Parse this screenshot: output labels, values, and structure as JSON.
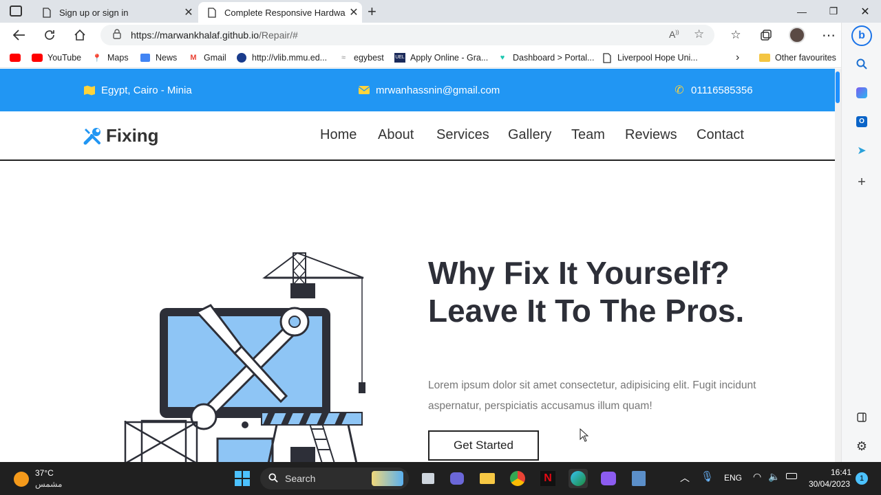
{
  "browser": {
    "tabs": [
      {
        "title": "Sign up or sign in",
        "active": false
      },
      {
        "title": "Complete Responsive Hardware",
        "active": true
      }
    ],
    "url": {
      "host": "https://marwankhalaf.github.io",
      "path": "/Repair/#"
    },
    "bookmarks": [
      {
        "label": "",
        "icon": "youtube-icon"
      },
      {
        "label": "YouTube",
        "icon": "youtube-icon"
      },
      {
        "label": "Maps",
        "icon": "maps-icon"
      },
      {
        "label": "News",
        "icon": "news-icon"
      },
      {
        "label": "Gmail",
        "icon": "gmail-icon"
      },
      {
        "label": "http://vlib.mmu.ed...",
        "icon": "globe-icon"
      },
      {
        "label": "egybest",
        "icon": "site-icon"
      },
      {
        "label": "Apply Online - Gra...",
        "icon": "uel-icon"
      },
      {
        "label": "Dashboard > Portal...",
        "icon": "heart-icon"
      },
      {
        "label": "Liverpool Hope Uni...",
        "icon": "page-icon"
      }
    ],
    "other_favourites": "Other favourites"
  },
  "site": {
    "topbar": {
      "location": "Egypt, Cairo - Minia",
      "email": "mrwanhassnin@gmail.com",
      "phone": "01116585356"
    },
    "logo": "Fixing",
    "nav": [
      "Home",
      "About",
      "Services",
      "Gallery",
      "Team",
      "Reviews",
      "Contact"
    ],
    "hero": {
      "title": "Why Fix It Yourself? Leave It To The Pros.",
      "text": "Lorem ipsum dolor sit amet consectetur, adipisicing elit. Fugit incidunt aspernatur, perspiciatis accusamus illum quam!",
      "button": "Get Started"
    },
    "colors": {
      "primary": "#2196f3",
      "dark": "#2d2f38",
      "illustration_blue": "#8ec5f5"
    }
  },
  "taskbar": {
    "weather": {
      "temp": "37°C",
      "desc": "مشمس"
    },
    "search_label": "Search",
    "lang": "ENG",
    "time": "16:41",
    "date": "30/04/2023",
    "notifications": "1"
  }
}
